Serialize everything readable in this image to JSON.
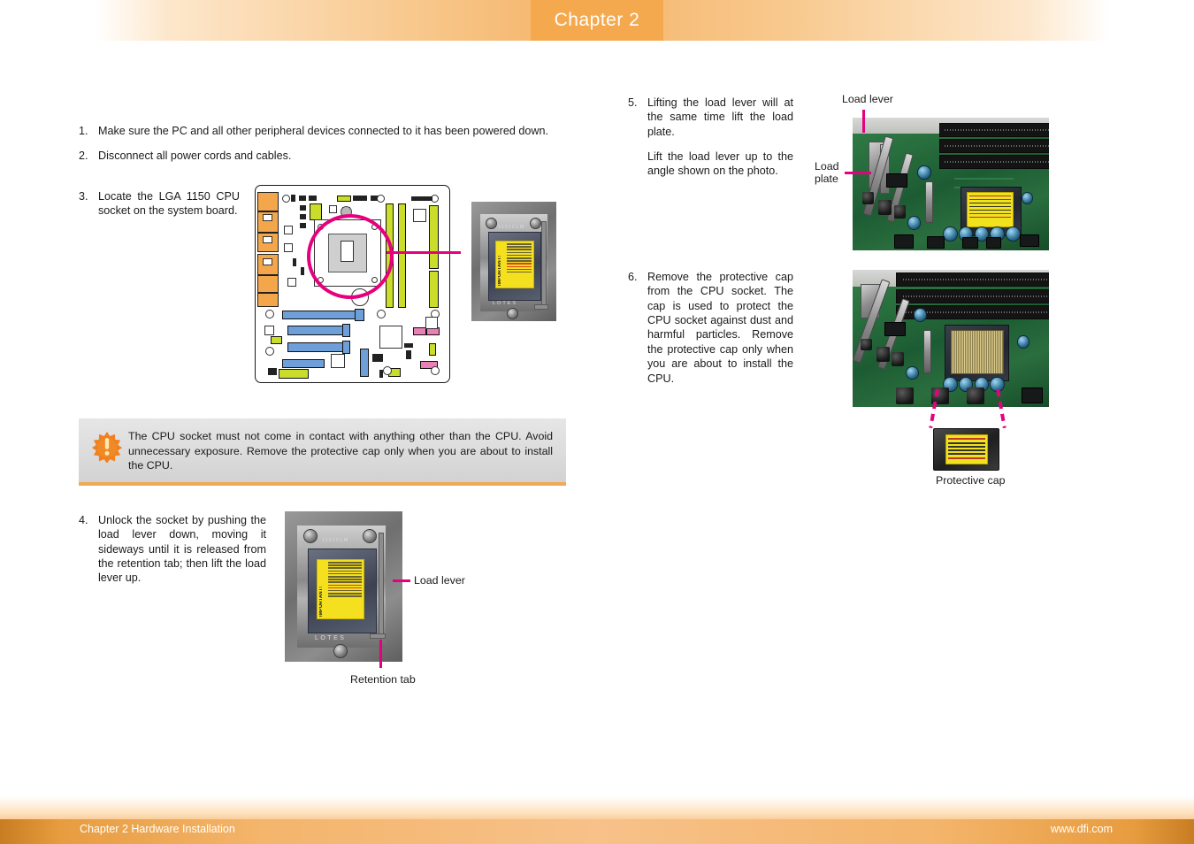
{
  "header": {
    "chapter_tab": "Chapter 2"
  },
  "footer": {
    "left": "Chapter 2 Hardware Installation",
    "right": "www.dfi.com"
  },
  "colors": {
    "accent_orange": "#f5a94e",
    "callout_magenta": "#e6007e",
    "warning_border": "#f0a955",
    "warning_bg": "#dcdcdc"
  },
  "steps": [
    {
      "num": "1.",
      "text": "Make sure the PC and all other peripheral devices connected to it has been powered down."
    },
    {
      "num": "2.",
      "text": "Disconnect all power cords and cables."
    },
    {
      "num": "3.",
      "text": "Locate the LGA 1150 CPU socket on the system board."
    },
    {
      "num": "4.",
      "text": "Unlock the socket by pushing the load lever down, moving it sideways until it is released from the retention tab; then lift the load lever up."
    },
    {
      "num": "5.",
      "text": "Lifting the load lever will at the same time lift the load plate.",
      "text2": "Lift the load lever up to the angle shown on the photo."
    },
    {
      "num": "6.",
      "text": "Remove the protective cap from the CPU socket. The cap is used to protect the CPU socket against dust and harmful particles. Remove the protective cap only when you are about to install the CPU."
    }
  ],
  "warning": {
    "icon": "warning-starburst-icon",
    "text": "The CPU socket must not come in contact with anything other than the CPU. Avoid unnecessary exposure. Remove the protective cap only when you are about to install the CPU."
  },
  "callouts": {
    "load_lever_step4": "Load lever",
    "retention_tab_step4": "Retention tab",
    "load_lever_step5": "Load lever",
    "load_plate_step5": "Load\nplate",
    "load_plate_line1": "Load",
    "load_plate_line2": "plate",
    "protective_cap": "Protective cap"
  },
  "socket_label": {
    "important": "IMPORTANT!",
    "brand": "LOTES",
    "code": "1151CLM"
  }
}
